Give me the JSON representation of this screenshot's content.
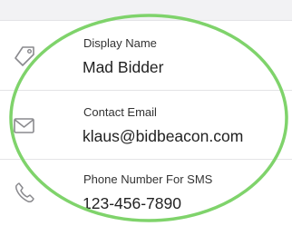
{
  "contact_form": {
    "fields": [
      {
        "label": "Display Name",
        "value": "Mad Bidder",
        "icon": "tag-icon"
      },
      {
        "label": "Contact Email",
        "value": "klaus@bidbeacon.com",
        "icon": "envelope-icon"
      },
      {
        "label": "Phone Number For SMS",
        "value": "123-456-7890",
        "icon": "phone-icon"
      }
    ]
  },
  "colors": {
    "highlight_circle": "#7fd36b",
    "icon_stroke": "#8a8a8e",
    "divider": "#e4e4e6"
  }
}
